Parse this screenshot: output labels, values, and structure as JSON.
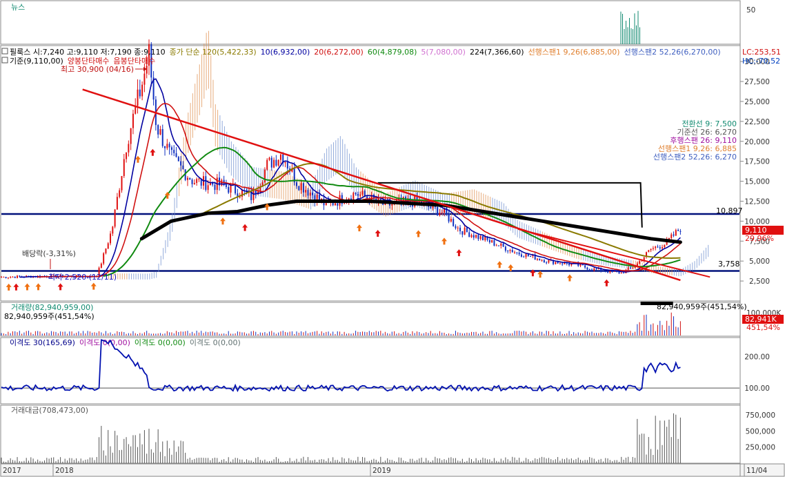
{
  "panels": {
    "news": {
      "title": "뉴스",
      "axis_label": "50"
    },
    "price": {
      "header_row1": [
        {
          "text": "필룩스 시:7,240 고:9,110 저:7,190 종:9,110",
          "color": "#000000"
        },
        {
          "text": "종가 단순 120(5,422,33)",
          "color": "#8a7a00"
        },
        {
          "text": "10(6,932,00)",
          "color": "#0000a0"
        },
        {
          "text": "20(6,272,00)",
          "color": "#d01010"
        },
        {
          "text": "60(4,879,08)",
          "color": "#108a10"
        },
        {
          "text": "5(7,080,00)",
          "color": "#d070d0"
        },
        {
          "text": "224(7,366,60)",
          "color": "#000000"
        },
        {
          "text": "선행스팬1 9,26(6,885,00)",
          "color": "#e08030"
        },
        {
          "text": "선행스팬2 52,26(6,270,00)",
          "color": "#4060c0"
        }
      ],
      "header_row2": [
        {
          "text": "기준(9,110,00)",
          "color": "#000000"
        },
        {
          "text": "양봉단타매수",
          "color": "#d01010"
        },
        {
          "text": "음봉단타매수",
          "color": "#d01010"
        }
      ],
      "lc": "LC:253,51",
      "hc": "HC:-70,52",
      "high_note": "최고 30,900 (04/16)",
      "low_note": "최저 2,520 (12/11)",
      "dividend_note": "배당락(-3,31%)",
      "legend_right": [
        {
          "text": "전환선 9: 7,500",
          "color": "#108a70"
        },
        {
          "text": "기준선 26: 6,270",
          "color": "#555555"
        },
        {
          "text": "후행스팬 26: 9,110",
          "color": "#a010a0"
        },
        {
          "text": "선행스팬1 9,26: 6,885",
          "color": "#e08030"
        },
        {
          "text": "선행스팬2 52,26: 6,270",
          "color": "#4060c0"
        }
      ],
      "hline_labels": [
        "10,897",
        "3,758"
      ],
      "price_box": "9,110",
      "pct_box": "29,96%",
      "vol_note_right": "82,940,959주(451,54%)"
    },
    "volume": {
      "title": "거래량(82,940,959,00)",
      "sub": "82,940,959주(451,54%)",
      "box_value": "82,941K",
      "box_pct": "451,54%",
      "axis_label": "100,000K"
    },
    "disparity": {
      "title_parts": [
        {
          "text": "이격도 30(165,69)",
          "color": "#00008a"
        },
        {
          "text": "이격도 0(0,00)",
          "color": "#a010a0"
        },
        {
          "text": "이격도 0(0,00)",
          "color": "#108a10"
        },
        {
          "text": "이격도 0(0,00)",
          "color": "#607070"
        }
      ]
    },
    "amount": {
      "title": "거래대금(708,473,00)"
    }
  },
  "x_axis_labels": [
    "2017",
    "2018",
    "2019",
    "11/04"
  ],
  "chart_data": [
    {
      "type": "line",
      "name": "price",
      "x": [
        "2017",
        "2018",
        "2019",
        "11/04"
      ],
      "y_ticks": [
        2500,
        5000,
        7500,
        10000,
        12500,
        15000,
        17500,
        20000,
        22500,
        25000,
        27500,
        30000
      ],
      "ylim": [
        0,
        32000
      ],
      "close_path": [
        [
          0,
          3000
        ],
        [
          0.06,
          3100
        ],
        [
          0.12,
          3050
        ],
        [
          0.13,
          3300
        ],
        [
          0.15,
          9000
        ],
        [
          0.17,
          20000
        ],
        [
          0.19,
          27000
        ],
        [
          0.2,
          30900
        ],
        [
          0.21,
          22000
        ],
        [
          0.23,
          18000
        ],
        [
          0.26,
          15000
        ],
        [
          0.3,
          14500
        ],
        [
          0.34,
          13000
        ],
        [
          0.36,
          17000
        ],
        [
          0.38,
          18500
        ],
        [
          0.4,
          15000
        ],
        [
          0.44,
          12000
        ],
        [
          0.48,
          13500
        ],
        [
          0.52,
          12000
        ],
        [
          0.56,
          12500
        ],
        [
          0.6,
          11000
        ],
        [
          0.62,
          9000
        ],
        [
          0.66,
          7500
        ],
        [
          0.7,
          6000
        ],
        [
          0.74,
          5000
        ],
        [
          0.78,
          4500
        ],
        [
          0.8,
          4000
        ],
        [
          0.84,
          3500
        ],
        [
          0.86,
          4500
        ],
        [
          0.88,
          6500
        ],
        [
          0.9,
          7200
        ],
        [
          0.92,
          9110
        ]
      ],
      "hlines": [
        10897,
        3758
      ],
      "ma224_path": [
        [
          0.19,
          7800
        ],
        [
          0.23,
          10000
        ],
        [
          0.28,
          11000
        ],
        [
          0.32,
          11200
        ],
        [
          0.36,
          12000
        ],
        [
          0.4,
          12500
        ],
        [
          0.5,
          12500
        ],
        [
          0.6,
          12000
        ],
        [
          0.7,
          10500
        ],
        [
          0.8,
          9000
        ],
        [
          0.88,
          7800
        ],
        [
          0.92,
          7366
        ]
      ],
      "trendline": [
        [
          0.11,
          26500
        ],
        [
          0.92,
          2600
        ]
      ]
    },
    {
      "type": "bar",
      "name": "volume",
      "recent_spike": 82940959
    },
    {
      "type": "line",
      "name": "disparity",
      "y_ticks": [
        100,
        200
      ],
      "last_value": 165.69
    },
    {
      "type": "bar",
      "name": "amount",
      "y_ticks": [
        250000,
        500000,
        750000
      ],
      "last_value": 708473
    }
  ]
}
